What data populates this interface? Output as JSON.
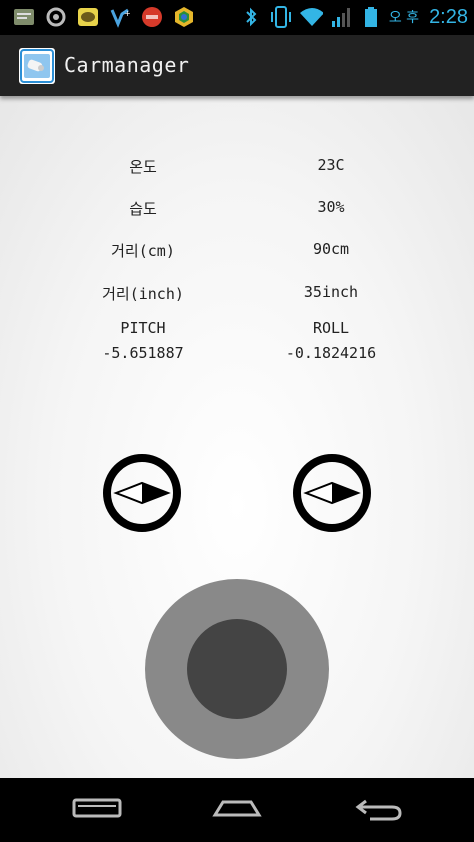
{
  "status_bar": {
    "icons": [
      "sms-app-icon",
      "settings-app-icon",
      "kakaotalk-icon",
      "vine-icon",
      "coupon-app-icon",
      "chrome-icon",
      "bluetooth-icon",
      "vibrate-icon",
      "wifi-icon",
      "signal-icon",
      "battery-icon"
    ],
    "ime": "오 후",
    "time": "2:28",
    "accent": "#33b5e5"
  },
  "action_bar": {
    "title": "Carmanager"
  },
  "sensors": {
    "rows": [
      {
        "label": "온도",
        "value": "23C"
      },
      {
        "label": "습도",
        "value": "30%"
      },
      {
        "label": "거리(cm)",
        "value": "90cm"
      },
      {
        "label": "거리(inch)",
        "value": "35inch"
      }
    ],
    "pitch_label": "PITCH",
    "pitch_value": "-5.651887",
    "roll_label": "ROLL",
    "roll_value": "-0.1824216"
  },
  "colors": {
    "joystick_outer": "#898989",
    "joystick_knob": "#444444"
  },
  "nav_bar": {
    "buttons": [
      "recent-apps-icon",
      "home-icon",
      "back-icon"
    ]
  }
}
